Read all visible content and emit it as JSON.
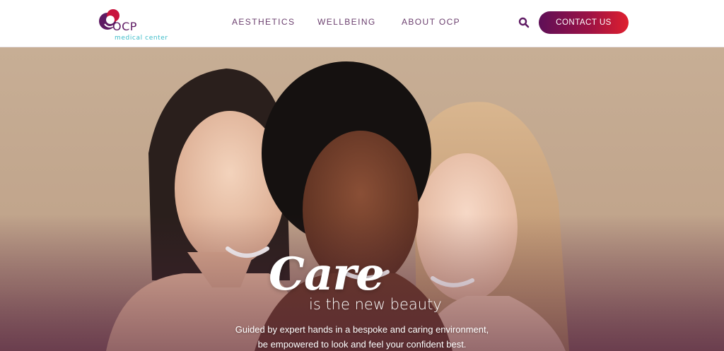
{
  "header": {
    "logo": {
      "name": "OCP",
      "subtitle": "medical center"
    },
    "nav": [
      {
        "label": "AESTHETICS"
      },
      {
        "label": "WELLBEING"
      },
      {
        "label": "ABOUT OCP"
      }
    ],
    "search_icon": "search-icon",
    "contact_label": "CONTACT US"
  },
  "hero": {
    "title": "Care",
    "tagline": "is the new beauty",
    "subtitle_line1": "Guided by expert hands in a bespoke and caring environment,",
    "subtitle_line2": "be empowered to look and feel your confident best."
  },
  "colors": {
    "brand_purple": "#5e1a63",
    "brand_teal": "#3cbcc9",
    "button_gradient_start": "#5e0f57",
    "button_gradient_end": "#df1f2e",
    "nav_text": "#6b3f6e"
  }
}
